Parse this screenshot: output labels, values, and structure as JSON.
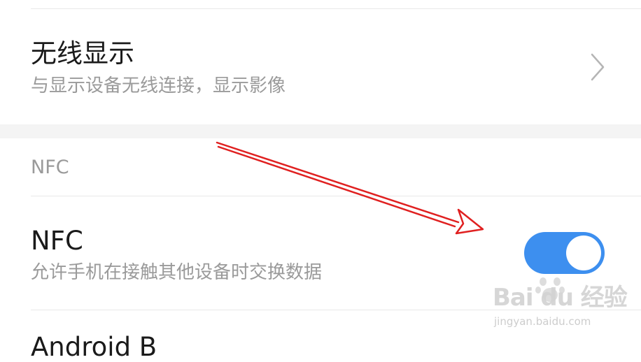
{
  "wireless_display": {
    "title": "无线显示",
    "subtitle": "与显示设备无线连接，显示影像",
    "icon": "chevron-right-icon"
  },
  "nfc_section": {
    "header": "NFC"
  },
  "nfc_row": {
    "title": "NFC",
    "subtitle": "允许手机在接触其他设备时交换数据",
    "toggle_on": true,
    "toggle_color": "#3d8fef"
  },
  "next_row": {
    "title_partial": "Android B"
  },
  "annotation": {
    "arrow_color": "#e02020"
  },
  "watermark": {
    "brand": "Bai du 经验",
    "url": "jingyan.baidu.com"
  }
}
